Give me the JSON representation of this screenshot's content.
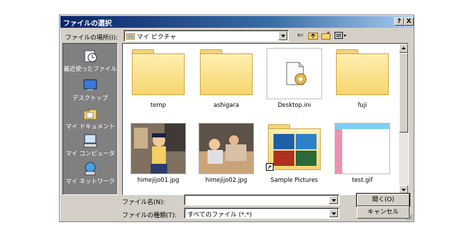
{
  "window": {
    "title": "ファイルの選択",
    "help_label": "?",
    "close_label": "X"
  },
  "location": {
    "label": "ファイルの場所(I):",
    "value": "マイ ピクチャ"
  },
  "places": [
    {
      "label": "最近使ったファイル",
      "icon": "recent-files-icon"
    },
    {
      "label": "デスクトップ",
      "icon": "desktop-icon"
    },
    {
      "label": "マイ ドキュメント",
      "icon": "my-documents-icon"
    },
    {
      "label": "マイ コンピュータ",
      "icon": "my-computer-icon"
    },
    {
      "label": "マイ ネットワーク",
      "icon": "my-network-icon"
    }
  ],
  "files": [
    {
      "name": "temp",
      "kind": "folder"
    },
    {
      "name": "ashigara",
      "kind": "folder"
    },
    {
      "name": "Desktop.ini",
      "kind": "settings-file"
    },
    {
      "name": "fuji",
      "kind": "folder"
    },
    {
      "name": "himejijo01.jpg",
      "kind": "photo"
    },
    {
      "name": "himejijo02.jpg",
      "kind": "photo"
    },
    {
      "name": "Sample Pictures",
      "kind": "shortcut-folder"
    },
    {
      "name": "test.gif",
      "kind": "image"
    }
  ],
  "filename": {
    "label": "ファイル名(N):",
    "value": ""
  },
  "filetype": {
    "label": "ファイルの種類(T):",
    "value": "すべてのファイル (*.*)"
  },
  "buttons": {
    "open": "開く(O)",
    "cancel": "キャンセル"
  }
}
